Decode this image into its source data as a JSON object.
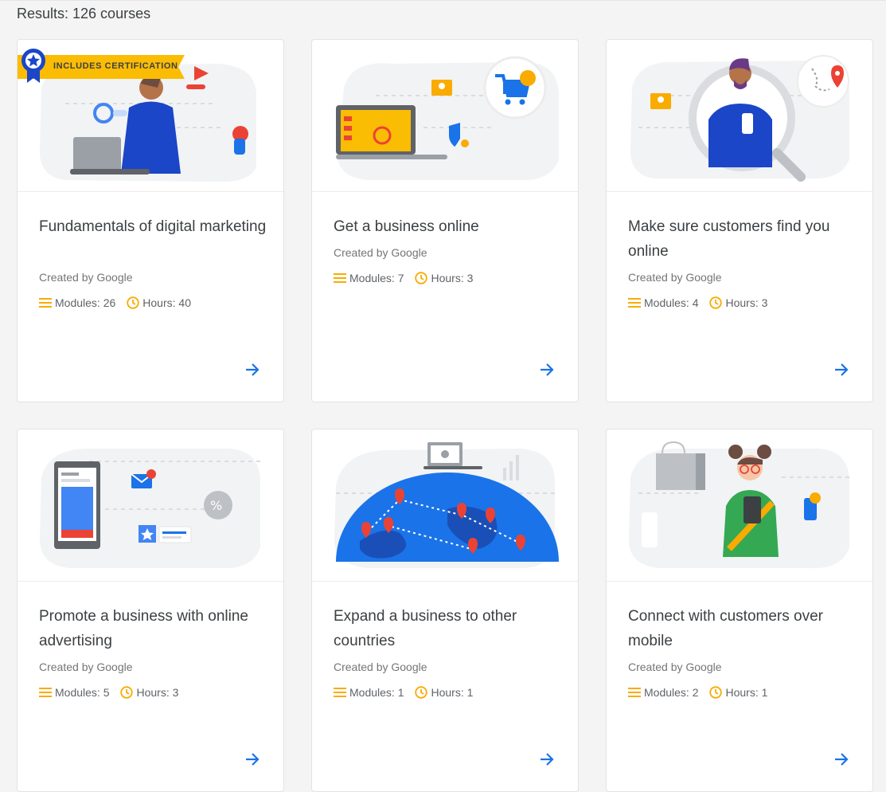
{
  "results_label": "Results: 126 courses",
  "badge_label": "INCLUDES CERTIFICATION",
  "colors": {
    "accent_blue": "#1a73e8",
    "badge_yellow": "#fbbc04",
    "icon_yellow": "#f9ab00"
  },
  "courses": [
    {
      "title": "Fundamentals of digital marketing",
      "creator": "Created by Google",
      "modules": "Modules: 26",
      "hours": "Hours: 40",
      "certification": true,
      "illustration": "laptop-person-illustration"
    },
    {
      "title": "Get a business online",
      "creator": "Created by Google",
      "modules": "Modules: 7",
      "hours": "Hours: 3",
      "certification": false,
      "illustration": "laptop-shopping-cart-illustration"
    },
    {
      "title": "Make sure customers find you online",
      "creator": "Created by Google",
      "modules": "Modules: 4",
      "hours": "Hours: 3",
      "certification": false,
      "illustration": "magnifier-person-illustration"
    },
    {
      "title": "Promote a business with online advertising",
      "creator": "Created by Google",
      "modules": "Modules: 5",
      "hours": "Hours: 3",
      "certification": false,
      "illustration": "phone-ad-illustration"
    },
    {
      "title": "Expand a business to other countries",
      "creator": "Created by Google",
      "modules": "Modules: 1",
      "hours": "Hours: 1",
      "certification": false,
      "illustration": "globe-pins-illustration"
    },
    {
      "title": "Connect with customers over mobile",
      "creator": "Created by Google",
      "modules": "Modules: 2",
      "hours": "Hours: 1",
      "certification": false,
      "illustration": "person-phone-illustration"
    }
  ]
}
